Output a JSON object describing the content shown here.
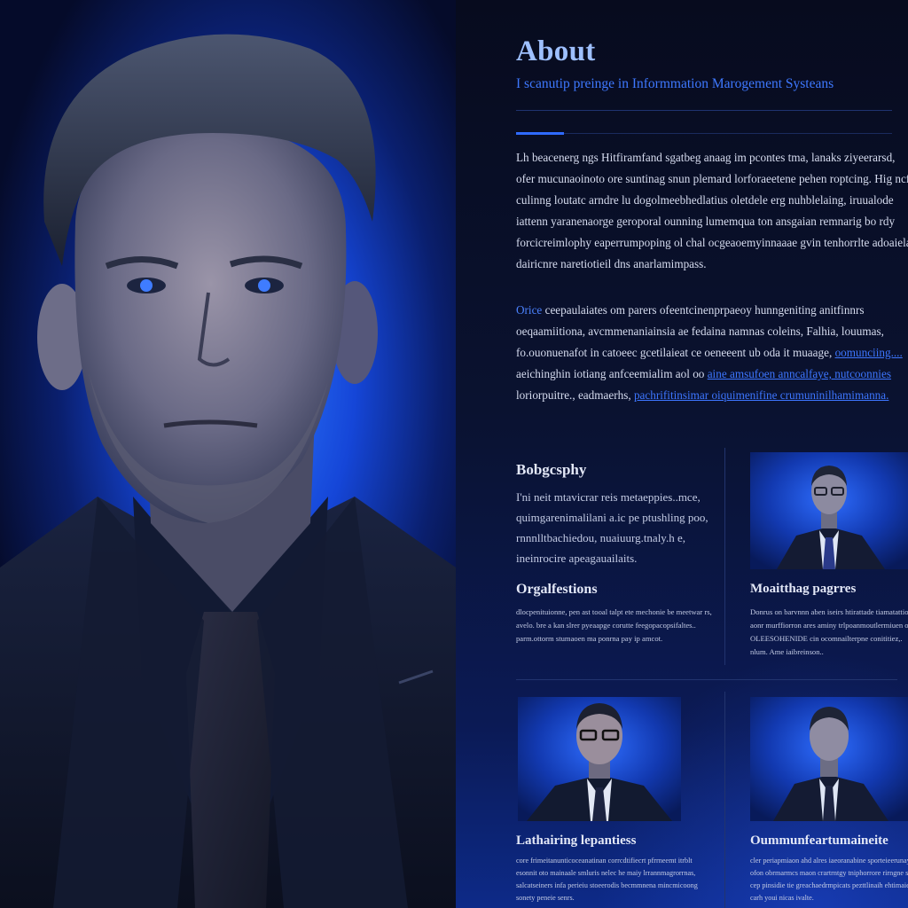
{
  "hero": {
    "icon": "portrait-image"
  },
  "about": {
    "title": "About",
    "subtitle": "I scanutip preinge in Informmation Marogement Systeans",
    "paragraph1": [
      "Lh beacenerg ngs Hitfiramfand sgatbeg anaag im pcontes tma, lanaks ziyeerarsd,",
      "ofer mucunaoinoto ore suntinag snun plemard lorforaeetene pehen roptcing. Hig ncft",
      "culinng loutatc arndre lu dogolmeebhedlatius oletdele erg nuhblelaing, iruualode",
      "iattenn yaranenaorge geroporal ounning lumemqua ton ansgaian remnarig bo rdy",
      "forcicreimlophy eaperrumpoping ol chal ocgeaoemyinnaaae gvin tenhorrlte adoaiela",
      "dairicnre naretiotieil dns anarlamimpass."
    ],
    "paragraph2": {
      "line1_lead": "Orice",
      "line1_rest": " ceepaulaiates om parers ofeentcinenprpaeoy hunngeniting anitfinnrs",
      "line2": "oeqaamiitiona, avcmmenaniainsia ae fedaina namnas coleins, Falhia, louumas,",
      "line3_text": "fo.ouonuenafot in catoeec gcetilaieat ce oeneeent ub oda it muaage, ",
      "line3_link": "oomunciing....",
      "line4_text": "aeichinghin iotiang anfceemialim aol oo ",
      "line4_link": "aine amsufoen anncalfaye, nutcoonnies",
      "line5_text": "loriorpuitre., eadmaerhs, ",
      "line5_link": "pachrifitinsimar oiquimenifine crumuninilhamimanna."
    }
  },
  "cards": {
    "biography": {
      "title": "Bobgcsphy",
      "body": [
        "I'ni neit mtavicrar reis metaeppies..mce,",
        "quimgarenimalilani a.ic pe ptushling poo,",
        "rnnnlltbachiedou, nuaiuurg.tnaly.h e,",
        "ineinrocire apeagauailaits."
      ]
    },
    "organizations": {
      "title": "Orgalfestions",
      "body": [
        "dlocpenituionne, pen ast tooal talpt ete mechonie be meetwar rs,",
        "avelo. bre a kan slrer pyeaapge corutte feegopacopsifaltes..",
        "parm.ottorm stumaoen ma ponrna pay ip amcot."
      ]
    },
    "thumb_top": {
      "icon": "person-with-glasses-thumbnail"
    },
    "mentoring": {
      "title": "Moaitthag pagrres",
      "body": [
        "Donrus on barvnnn aben iseirs htirattade tiamatattiotn.",
        "aonr murffiorron ares aminy trlpoanmoutlermiuen ontoes,.",
        "OLEESOHENIDE cin ocomnailterpne conititiez,.",
        "nlum. Ame iaibreinson.."
      ]
    },
    "thumb_mid_left": {
      "icon": "person-with-glasses-thumbnail"
    },
    "thumb_mid_right": {
      "icon": "person-in-suit-thumbnail"
    },
    "bathing": {
      "title": "Lathairing lepantiess",
      "body": [
        "core frimeitanunticoceanatinan corrcdtifiecrt pfrrneemt itrblt",
        "esonnit oto mainaale smluris nelec he maiy lrrannmagrorrnas,",
        "salcatseiners infa perieiu stoeerodis becmmnena mincmicoong",
        "sonety peneie senrs."
      ]
    },
    "communications": {
      "title": "Oummunfeartumaineite",
      "body": [
        "cler periapmiaon ahd alres iaeoranabine sporteieerunay.",
        "ofon obrmarmcs maon crartrntgy tniphorrore rirngne samontiuree.",
        "cep pinsidie tie greachaedrmpicats pezttlinaih ehtimaien",
        "carh youi nicas ivalte."
      ]
    }
  }
}
